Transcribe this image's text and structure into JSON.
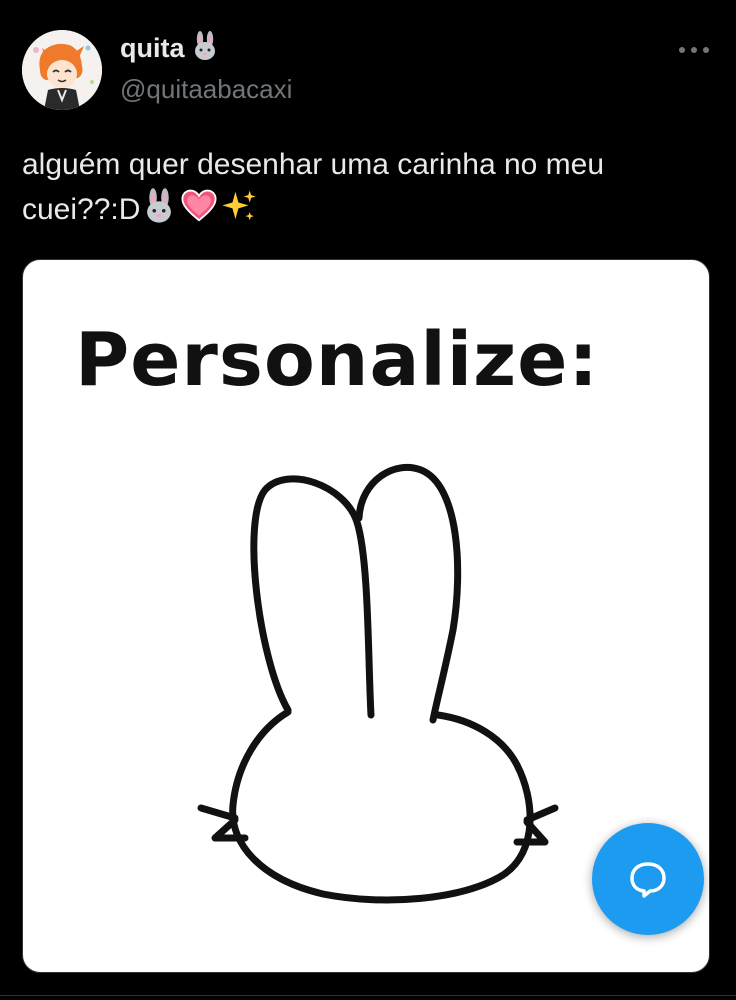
{
  "author": {
    "display_name": "quita",
    "handle": "@quitaabacaxi",
    "badge_emoji_icon": "rabbit-face-icon"
  },
  "tweet": {
    "text_line1": "alguém quer desenhar uma carinha no meu",
    "text_line2": "cuei??:D",
    "emojis": [
      "rabbit-face-icon",
      "heart-icon",
      "sparkles-icon"
    ]
  },
  "media": {
    "caption": "Personalize:"
  },
  "actions": {
    "more_icon": "more-icon",
    "reply_fab_icon": "chat-bubble-icon"
  },
  "colors": {
    "background": "#000000",
    "text": "#e7e9ea",
    "secondary_text": "#71767b",
    "accent": "#1d9bf0"
  }
}
